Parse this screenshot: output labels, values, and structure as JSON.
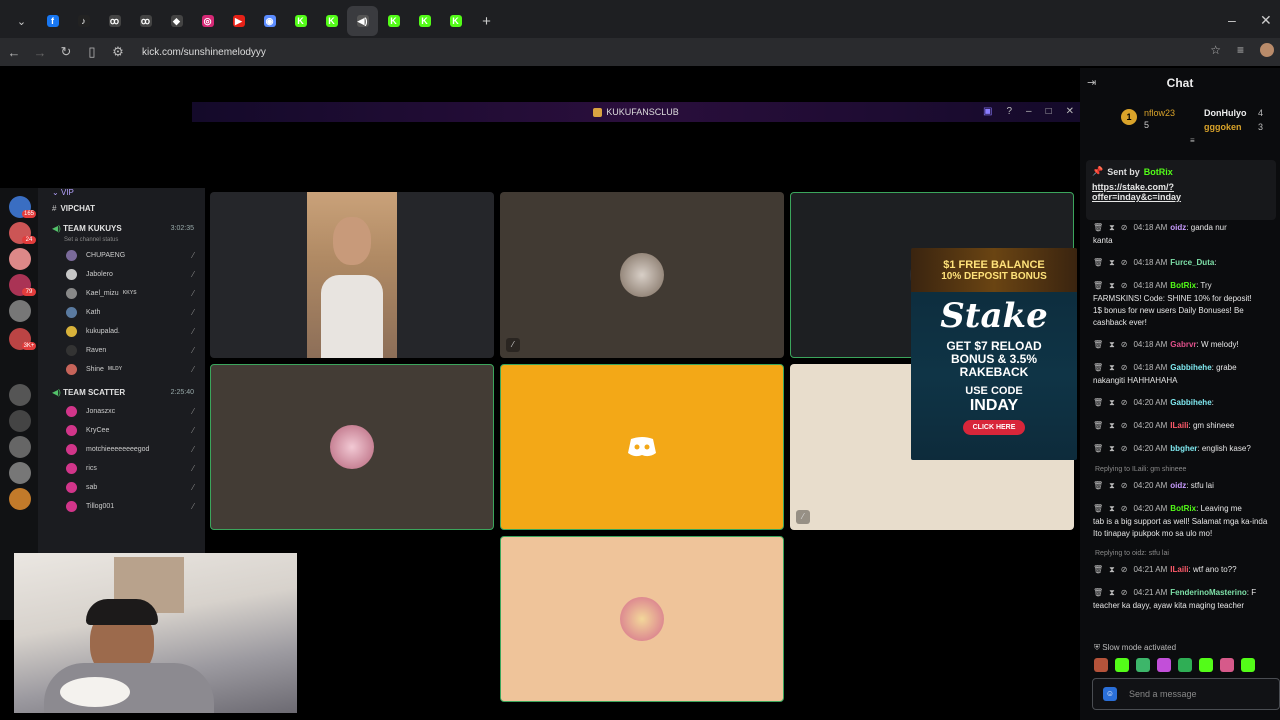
{
  "browser": {
    "url": "kick.com/sunshinemelodyyy",
    "tabs": [
      {
        "name": "facebook-tab",
        "glyph": "f",
        "color": "#1877f2"
      },
      {
        "name": "tiktok-tab",
        "glyph": "♪",
        "color": "#222"
      },
      {
        "name": "app-tab-1",
        "glyph": "ꝏ",
        "color": "#444"
      },
      {
        "name": "app-tab-2",
        "glyph": "ꝏ",
        "color": "#444"
      },
      {
        "name": "app-tab-3",
        "glyph": "◆",
        "color": "#444"
      },
      {
        "name": "instagram-tab",
        "glyph": "◎",
        "color": "#d62976"
      },
      {
        "name": "youtube-tab",
        "glyph": "▶",
        "color": "#e62117"
      },
      {
        "name": "messenger-tab",
        "glyph": "◉",
        "color": "#5b8cff"
      },
      {
        "name": "kick-tab-1",
        "glyph": "K",
        "color": "#53fc18"
      },
      {
        "name": "kick-tab-2",
        "glyph": "K",
        "color": "#53fc18"
      },
      {
        "name": "audio-tab",
        "glyph": "◀)",
        "color": "#555"
      },
      {
        "name": "kick-tab-3",
        "glyph": "K",
        "color": "#53fc18"
      },
      {
        "name": "kick-tab-4",
        "glyph": "K",
        "color": "#53fc18"
      },
      {
        "name": "kick-tab-5",
        "glyph": "K",
        "color": "#53fc18"
      }
    ],
    "new_tab": "+"
  },
  "discord": {
    "window_title": "KUKUFANSCLUB",
    "server_badges": [
      "165",
      "24",
      "79",
      "3K+"
    ],
    "vip_label": "VIP",
    "vipchat_label": "VIPCHAT",
    "team1": {
      "name": "TEAM KUKUYS",
      "time": "3:02:35",
      "status": "Set a channel status",
      "members": [
        "CHUPAENG",
        "Jabolero",
        "Kael_mizu",
        "Kath",
        "kukupalad.",
        "Raven",
        "Shine"
      ],
      "tags": [
        "",
        "",
        "KKYS",
        "",
        "",
        "",
        "MLDY"
      ]
    },
    "team2": {
      "name": "TEAM SCATTER",
      "time": "2:25:40",
      "members": [
        "Jonaszxc",
        "KryCee",
        "motchieeeeeeeegod",
        "rics",
        "sab",
        "Tillog001"
      ]
    }
  },
  "ad": {
    "line1": "$1 FREE BALANCE",
    "line2": "10% DEPOSIT BONUS",
    "brand": "Stake",
    "offer1": "GET $7 RELOAD",
    "offer2": "BONUS & 3.5%",
    "offer3": "RAKEBACK",
    "use": "USE CODE",
    "code": "INDAY",
    "button": "CLICK HERE"
  },
  "chat": {
    "title": "Chat",
    "leaderboard": [
      {
        "rank": "1",
        "name": "nflow23",
        "count": "5"
      },
      {
        "name": "DonHulyo",
        "count": "4"
      },
      {
        "name": "gggoken",
        "count": "3"
      }
    ],
    "pinned": {
      "sent_by": "Sent by",
      "user": "BotRix",
      "link1": "https://stake.com/?",
      "link2": "offer=inday&c=inday"
    },
    "messages": [
      {
        "time": "04:18 AM",
        "user": "oidz",
        "color": "#c89bff",
        "text": ": ganda nur",
        "cont": "kanta"
      },
      {
        "time": "04:18 AM",
        "user": "Furce_Duta",
        "color": "#7ee0a8",
        "text": ":",
        "cont": ""
      },
      {
        "time": "04:18 AM",
        "user": "BotRix",
        "color": "#53fc18",
        "text": ": Try",
        "cont": "FARMSKINS! Code: SHINE 10% for deposit!",
        "cont2": "1$ bonus for new users  Daily Bonuses!  Be",
        "cont3": "cashback ever!"
      },
      {
        "time": "04:18 AM",
        "user": "Gabrvr",
        "color": "#e0508a",
        "text": ": W melody!",
        "cont": ""
      },
      {
        "time": "04:18 AM",
        "user": "Gabbihehe",
        "color": "#7fe9f0",
        "text": ": grabe",
        "cont": "nakangiti HAHHAHAHA"
      },
      {
        "time": "04:20 AM",
        "user": "Gabbihehe",
        "color": "#7fe9f0",
        "text": ":",
        "cont": ""
      },
      {
        "time": "04:20 AM",
        "user": "ILaili",
        "color": "#ff5a6a",
        "text": ": gm shineee",
        "cont": ""
      },
      {
        "time": "04:20 AM",
        "user": "bbgher",
        "color": "#7fe9f0",
        "text": ": english kase?",
        "cont": ""
      },
      {
        "time": "04:20 AM",
        "user": "oidz",
        "color": "#c89bff",
        "text": ": stfu lai",
        "cont": "",
        "reply": "Replying to ILaili: gm shineee"
      },
      {
        "time": "04:20 AM",
        "user": "BotRix",
        "color": "#53fc18",
        "text": ": Leaving me",
        "cont": "tab is a big support as well! Salamat mga ka-inda",
        "cont2": "Ito tinapay ipukpok mo sa ulo mo!"
      },
      {
        "time": "04:21 AM",
        "user": "ILaili",
        "color": "#ff5a6a",
        "text": ": wtf ano to??",
        "cont": "",
        "reply": "Replying to oidz: stfu lai"
      },
      {
        "time": "04:21 AM",
        "user": "FenderinoMasterino",
        "color": "#7ee0a8",
        "text": ": F",
        "cont": "teacher ka dayy, ayaw kita maging teacher"
      }
    ],
    "slow_mode": "Slow mode activated",
    "input_placeholder": "Send a message"
  }
}
